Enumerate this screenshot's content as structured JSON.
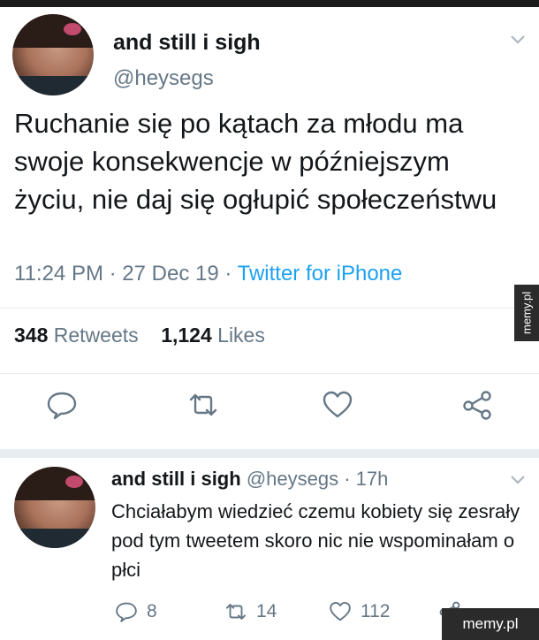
{
  "main_tweet": {
    "display_name": "and still i sigh",
    "handle": "@heysegs",
    "text": "Ruchanie się po kątach za młodu ma swoje konsekwencje w późniejszym życiu, nie daj się ogłupić społeczeństwu",
    "time": "11:24 PM",
    "date": "27 Dec 19",
    "source": "Twitter for iPhone",
    "dot": "·",
    "retweets_count": "348",
    "retweets_label": "Retweets",
    "likes_count": "1,124",
    "likes_label": "Likes",
    "icons": [
      "reply-icon",
      "retweet-icon",
      "like-icon",
      "share-icon",
      "chevron-down-icon"
    ]
  },
  "reply_tweet": {
    "display_name": "and still i sigh",
    "handle": "@heysegs",
    "dot": "·",
    "time_ago": "17h",
    "text": "Chciałabym wiedzieć czemu kobiety się zesrały pod tym tweetem skoro nic nie wspominałam o płci",
    "reply_count": "8",
    "retweet_count": "14",
    "like_count": "112",
    "icons": [
      "reply-icon",
      "retweet-icon",
      "like-icon",
      "share-icon",
      "chevron-down-icon"
    ]
  },
  "watermarks": {
    "side": "memy.pl",
    "corner": "memy.pl"
  },
  "colors": {
    "text": "#14171a",
    "secondary": "#657786",
    "link": "#1da1f2",
    "divider": "#e6ecf0"
  }
}
